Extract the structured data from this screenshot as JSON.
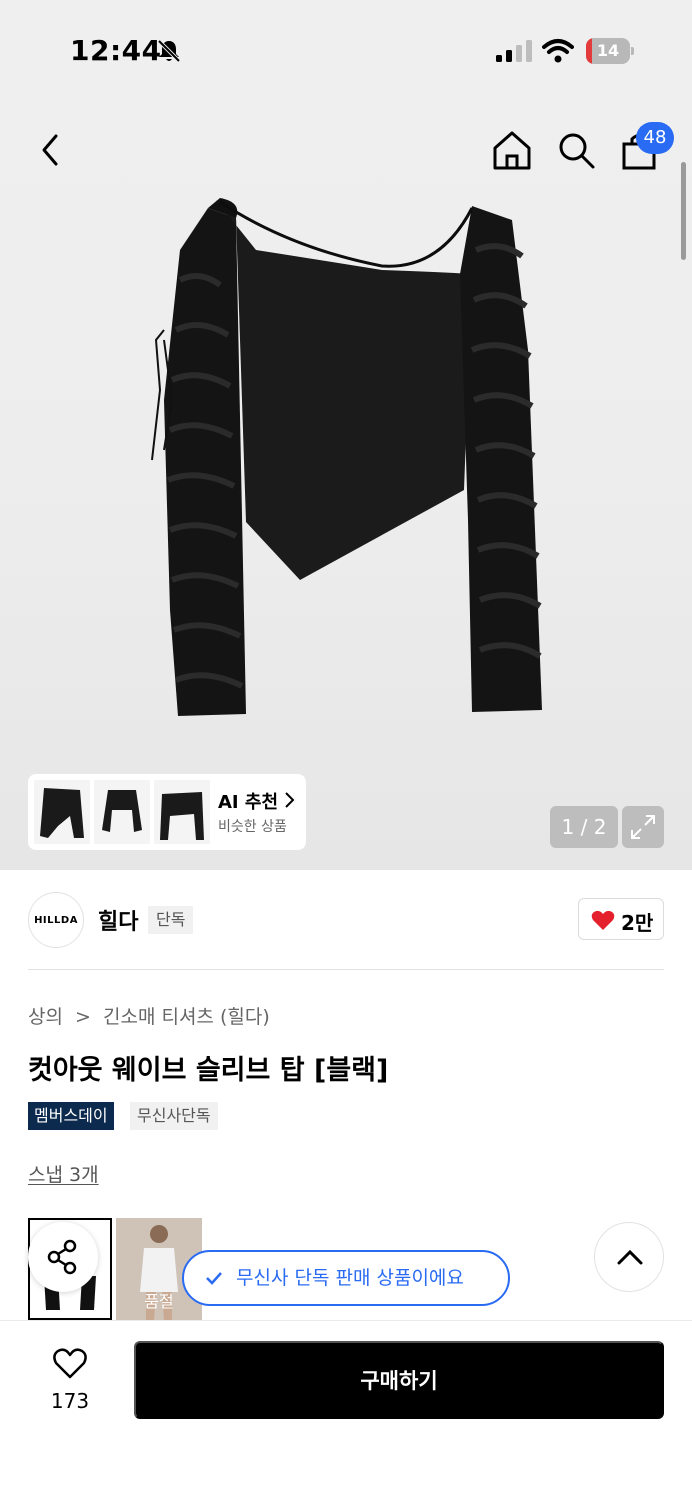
{
  "status_bar": {
    "time": "12:44",
    "battery": "14",
    "battery_level": 0.14
  },
  "header": {
    "cart_count": "48"
  },
  "gallery": {
    "page_counter": "1 / 2",
    "ai_recommend": {
      "title": "AI 추천",
      "subtitle": "비슷한 상품"
    }
  },
  "brand": {
    "logo_text": "HILLDA",
    "name": "힐다",
    "tag": "단독",
    "likes": "2만"
  },
  "product": {
    "breadcrumb": [
      "상의",
      ">",
      "긴소매 티셔츠 (힐다)"
    ],
    "title": "컷아웃 웨이브 슬리브 탑 [블랙]",
    "tags": [
      "멤버스데이",
      "무신사단독"
    ],
    "snap_link": "스냅 3개",
    "soldout_label": "품절"
  },
  "toast": {
    "exclusive_message": "무신사 단독 판매 상품이에요"
  },
  "bottom_bar": {
    "wish_count": "173",
    "buy_label": "구매하기"
  },
  "colors": {
    "accent": "#2a6bf3",
    "member_tag": "#0c2a4e",
    "heart": "#e3202c",
    "buy_button": "#000000"
  },
  "icons": [
    "bell-off-icon",
    "signal-icon",
    "wifi-icon",
    "battery-icon",
    "back-icon",
    "home-icon",
    "search-icon",
    "cart-icon",
    "chevron-right-icon",
    "expand-icon",
    "heart-icon",
    "share-icon",
    "check-icon",
    "chevron-up-icon"
  ]
}
